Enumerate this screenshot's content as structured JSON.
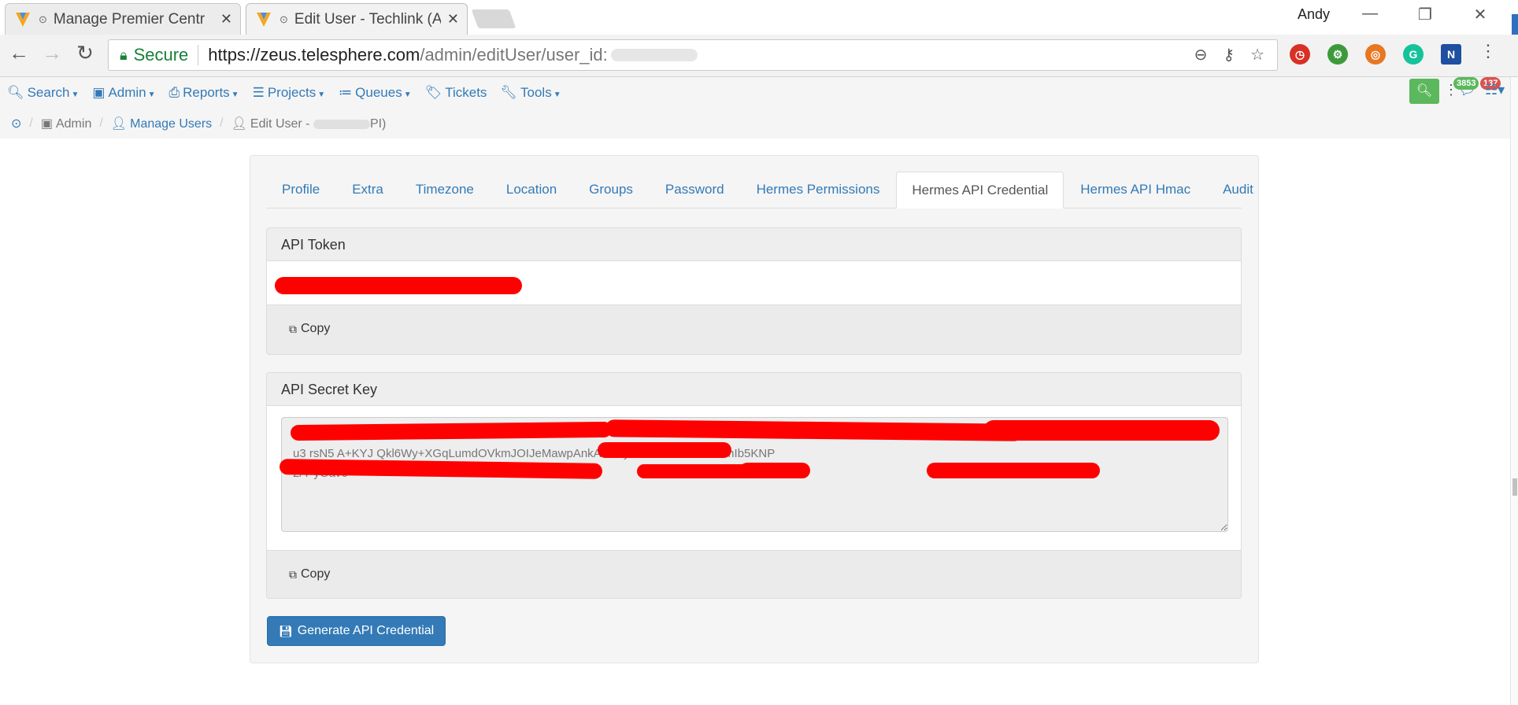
{
  "browser": {
    "tabs": [
      {
        "title": "Manage Premier Centr",
        "active": false
      },
      {
        "title": "Edit User - Techlink (AI",
        "active": true
      }
    ],
    "user": "Andy",
    "omnibox": {
      "secure_label": "Secure",
      "url_host": "https://zeus.telesphere.com",
      "url_path": "/admin/editUser/user_id:"
    }
  },
  "nav": {
    "items": [
      {
        "label": "Search",
        "icon": "search-icon",
        "dropdown": true
      },
      {
        "label": "Admin",
        "icon": "archive-icon",
        "dropdown": true
      },
      {
        "label": "Reports",
        "icon": "print-icon",
        "dropdown": true
      },
      {
        "label": "Projects",
        "icon": "projects-icon",
        "dropdown": true
      },
      {
        "label": "Queues",
        "icon": "list-icon",
        "dropdown": true
      },
      {
        "label": "Tickets",
        "icon": "tag-icon",
        "dropdown": false
      },
      {
        "label": "Tools",
        "icon": "wrench-icon",
        "dropdown": true
      }
    ],
    "badges": {
      "messages": "3853",
      "alerts": "137"
    }
  },
  "breadcrumb": {
    "admin": "Admin",
    "manage_users": "Manage Users",
    "edit_user_prefix": "Edit User - ",
    "edit_user_suffix": "PI)"
  },
  "tabs": [
    "Profile",
    "Extra",
    "Timezone",
    "Location",
    "Groups",
    "Password",
    "Hermes Permissions",
    "Hermes API Credential",
    "Hermes API Hmac",
    "Audit"
  ],
  "active_tab": "Hermes API Credential",
  "token_panel": {
    "title": "API Token",
    "copy_label": "Copy"
  },
  "secret_panel": {
    "title": "API Secret Key",
    "value": "bs60Q/U TixCSN\nu3 rsN5 A+KYJ Qkl6Wy+XGqLumdOVkmJOIJeMawpAnkA23luydIY7x6hsuWP44+mIb5KNP\n2/Y yGav6",
    "copy_label": "Copy"
  },
  "generate_button": "Generate API Credential"
}
